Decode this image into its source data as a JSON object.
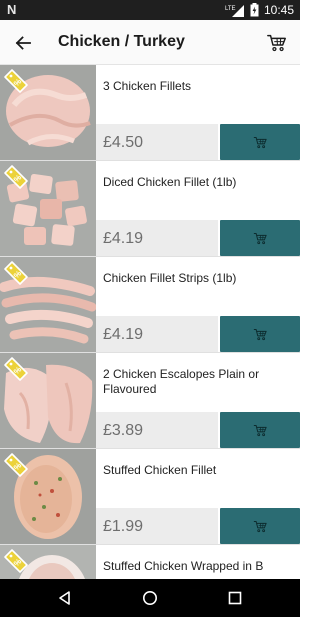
{
  "status_bar": {
    "notification_icon": "N",
    "network": "LTE",
    "time": "10:45"
  },
  "app_bar": {
    "title": "Chicken / Turkey",
    "back_icon": "arrow-left-icon",
    "cart_icon": "cart-icon"
  },
  "products": [
    {
      "name": "3 Chicken Fillets",
      "price": "£4.50",
      "badge": "offer-tag-icon"
    },
    {
      "name": "Diced Chicken Fillet (1lb)",
      "price": "£4.19",
      "badge": "offer-tag-icon"
    },
    {
      "name": "Chicken Fillet Strips (1lb)",
      "price": "£4.19",
      "badge": "offer-tag-icon"
    },
    {
      "name": "2 Chicken Escalopes Plain or Flavoured",
      "price": "£3.89",
      "badge": "offer-tag-icon"
    },
    {
      "name": "Stuffed Chicken Fillet",
      "price": "£1.99",
      "badge": "offer-tag-icon"
    },
    {
      "name": "Stuffed Chicken Wrapped in B",
      "price": "",
      "badge": "offer-tag-icon"
    }
  ],
  "colors": {
    "accent": "#2b6c73",
    "price_bg": "#ececec",
    "tag": "#ecd23a"
  }
}
